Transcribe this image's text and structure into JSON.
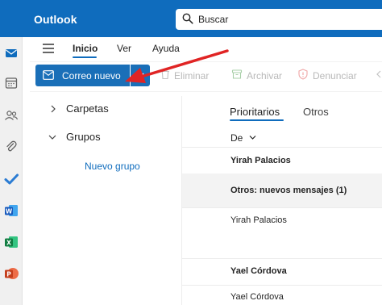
{
  "header": {
    "app_title": "Outlook",
    "search_placeholder": "Buscar",
    "brand_color": "#0f6cbd"
  },
  "rail": {
    "items": [
      {
        "icon": "mail-icon"
      },
      {
        "icon": "calendar-icon"
      },
      {
        "icon": "people-icon"
      },
      {
        "icon": "attach-icon"
      },
      {
        "icon": "todo-icon"
      },
      {
        "icon": "word-icon"
      },
      {
        "icon": "excel-icon"
      },
      {
        "icon": "powerpoint-icon"
      }
    ]
  },
  "menu": {
    "tabs": [
      "Inicio",
      "Ver",
      "Ayuda"
    ],
    "active": "Inicio"
  },
  "ribbon": {
    "new_mail_label": "Correo nuevo",
    "delete_label": "Eliminar",
    "archive_label": "Archivar",
    "report_label": "Denunciar"
  },
  "folders": {
    "carpetas_label": "Carpetas",
    "grupos_label": "Grupos",
    "new_group_label": "Nuevo grupo"
  },
  "message_list": {
    "pivots": [
      "Prioritarios",
      "Otros"
    ],
    "active_pivot": "Prioritarios",
    "sort_label": "De",
    "rows": [
      {
        "sender": "Yirah Palacios"
      },
      {
        "sender": "Otros: nuevos mensajes (1)"
      },
      {
        "sender": "Yirah Palacios"
      },
      {
        "sender": "Yael Córdova"
      },
      {
        "sender": "Yael Córdova"
      }
    ]
  },
  "annotation": {
    "arrow_color": "#e02424"
  }
}
